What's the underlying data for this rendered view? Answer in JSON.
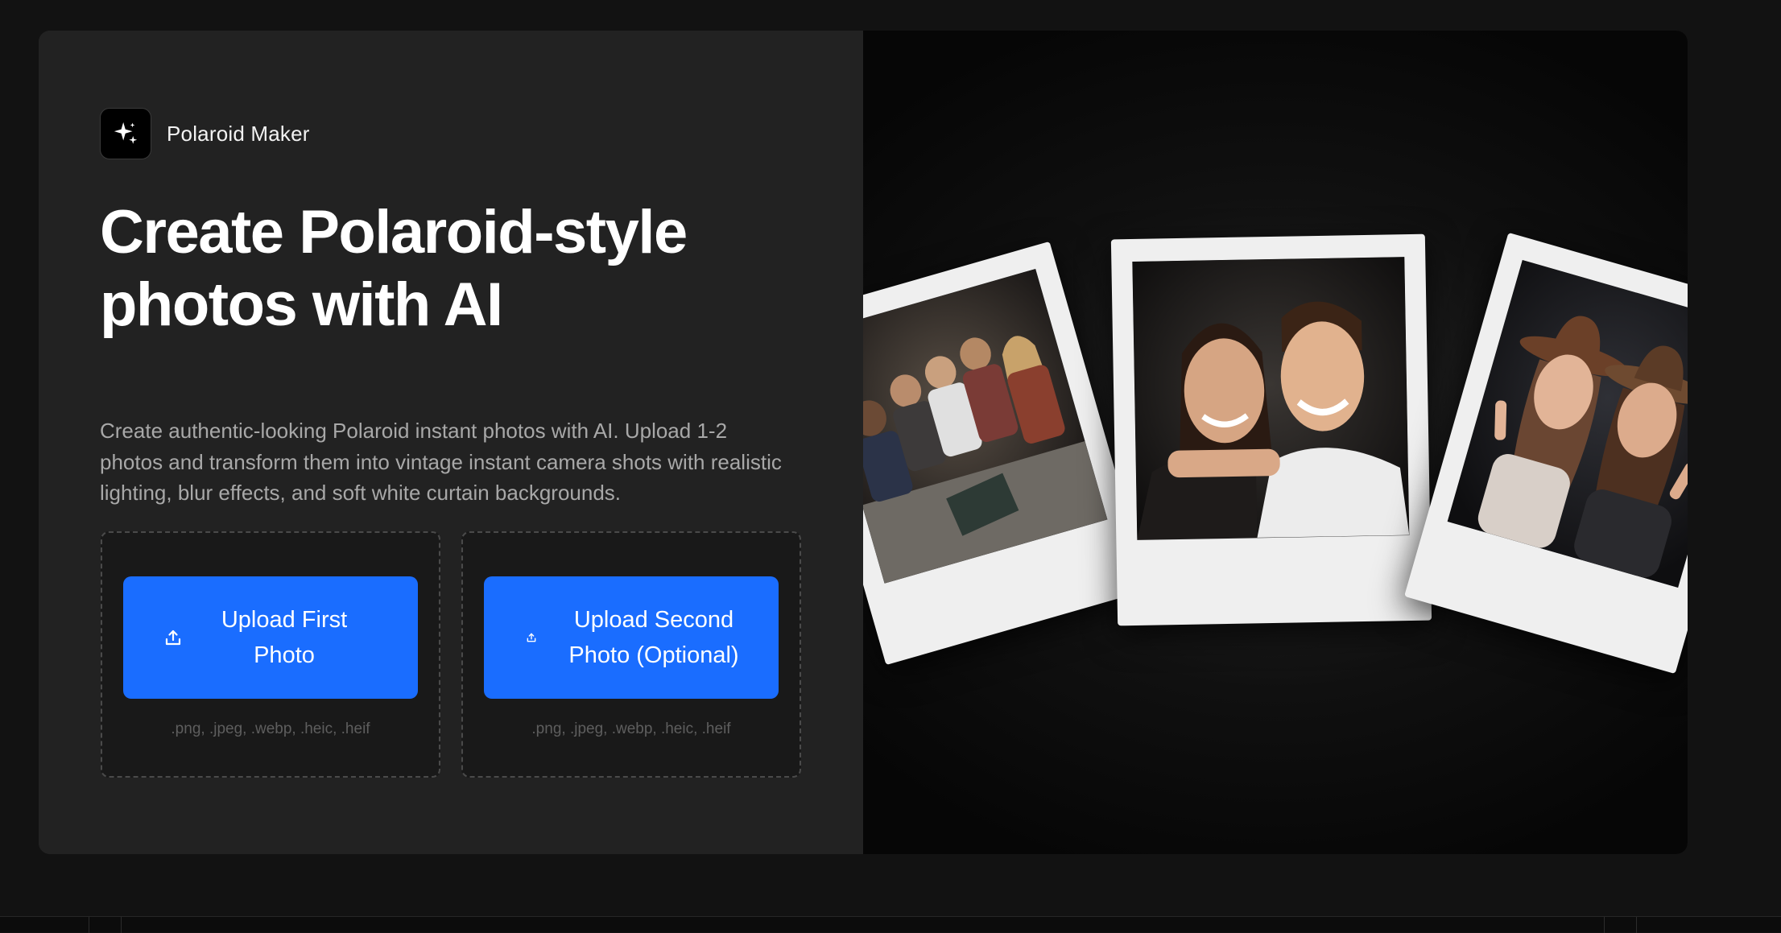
{
  "brand": {
    "name": "Polaroid Maker",
    "logo_icon": "sparkles-icon"
  },
  "hero": {
    "title": "Create Polaroid-style photos with AI",
    "description": "Create authentic-looking Polaroid instant photos with AI. Upload 1-2 photos and transform them into vintage instant camera shots with realistic lighting, blur effects, and soft white curtain backgrounds."
  },
  "uploads": [
    {
      "label": "Upload First Photo",
      "icon": "upload-icon",
      "formats": ".png, .jpeg, .webp, .heic, .heif"
    },
    {
      "label": "Upload Second Photo (Optional)",
      "icon": "upload-icon",
      "formats": ".png, .jpeg, .webp, .heic, .heif"
    }
  ],
  "colors": {
    "accent": "#1a6dff",
    "card": "#222222",
    "page": "#121212"
  }
}
